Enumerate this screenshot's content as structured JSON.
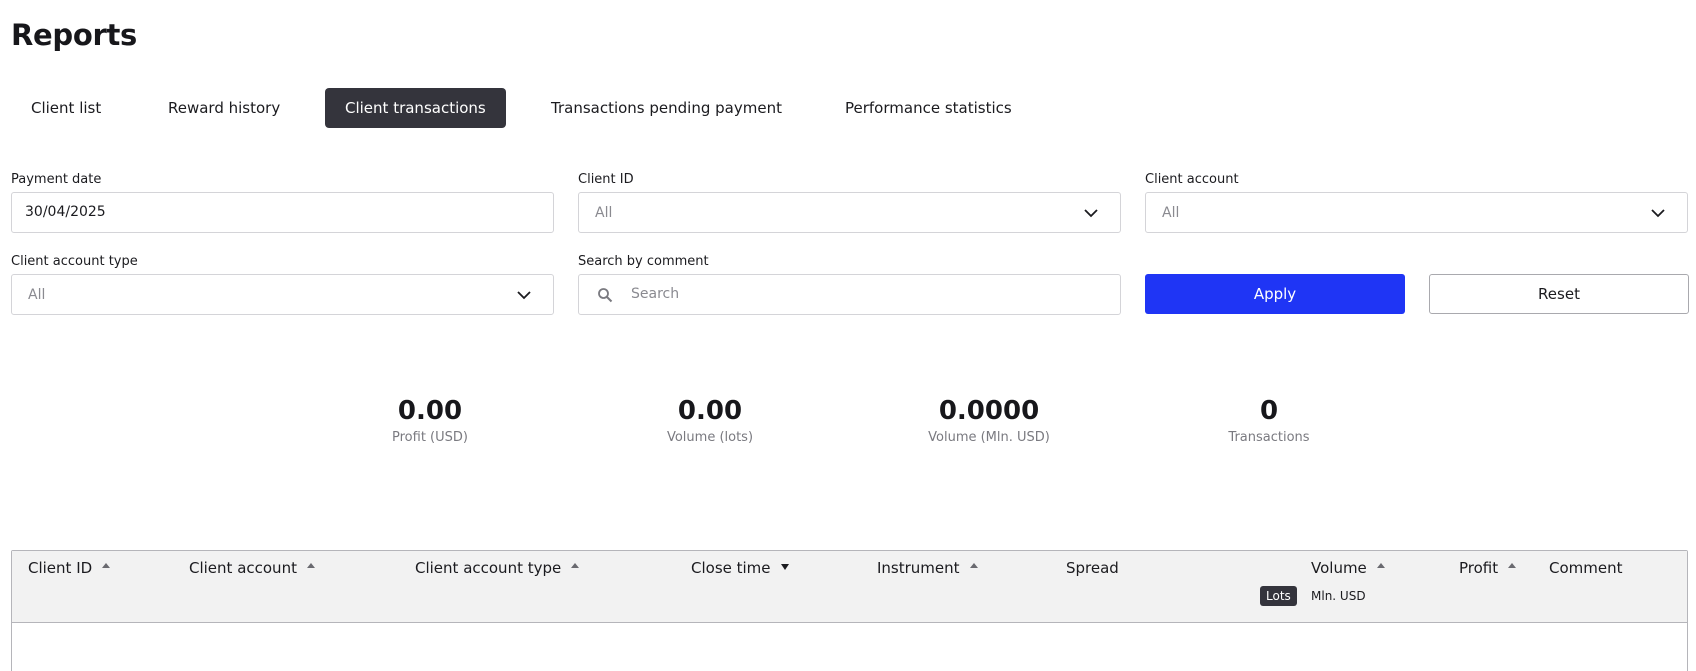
{
  "page": {
    "title": "Reports"
  },
  "tabs": [
    {
      "label": "Client list",
      "active": false
    },
    {
      "label": "Reward history",
      "active": false
    },
    {
      "label": "Client transactions",
      "active": true
    },
    {
      "label": "Transactions pending payment",
      "active": false
    },
    {
      "label": "Performance statistics",
      "active": false
    }
  ],
  "filters": {
    "payment_date": {
      "label": "Payment date",
      "value": "30/04/2025"
    },
    "client_id": {
      "label": "Client ID",
      "value": "All"
    },
    "client_account": {
      "label": "Client account",
      "value": "All"
    },
    "client_account_type": {
      "label": "Client account type",
      "value": "All"
    },
    "search_comment": {
      "label": "Search by comment",
      "placeholder": "Search"
    },
    "apply_label": "Apply",
    "reset_label": "Reset"
  },
  "stats": [
    {
      "value": "0.00",
      "label": "Profit (USD)"
    },
    {
      "value": "0.00",
      "label": "Volume (lots)"
    },
    {
      "value": "0.0000",
      "label": "Volume (Mln. USD)"
    },
    {
      "value": "0",
      "label": "Transactions"
    }
  ],
  "table": {
    "columns": [
      {
        "label": "Client ID",
        "sort": "asc"
      },
      {
        "label": "Client account",
        "sort": "asc"
      },
      {
        "label": "Client account type",
        "sort": "asc"
      },
      {
        "label": "Close time",
        "sort": "desc"
      },
      {
        "label": "Instrument",
        "sort": "asc"
      },
      {
        "label": "Spread",
        "sort": "none"
      },
      {
        "label": "Volume",
        "sort": "asc"
      },
      {
        "label": "Profit",
        "sort": "asc"
      },
      {
        "label": "Comment",
        "sort": "none"
      }
    ],
    "volume_units": [
      {
        "label": "Lots",
        "active": true
      },
      {
        "label": "Mln. USD",
        "active": false
      }
    ],
    "rows": []
  },
  "colors": {
    "accent": "#1f35f5",
    "active_tab": "#34343c",
    "header_bg": "#f2f2f2"
  }
}
